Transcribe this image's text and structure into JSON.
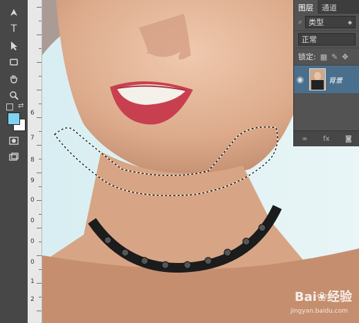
{
  "tools": {
    "pen": "pen-icon",
    "type": "T",
    "select": "arrow-icon",
    "shape": "rectangle-icon",
    "hand": "hand-icon",
    "zoom": "zoom-icon"
  },
  "colors": {
    "foreground": "#7fd3f0",
    "background": "#ffffff"
  },
  "ruler": {
    "labels": [
      "6",
      "7",
      "8",
      "9",
      "0",
      "0",
      "0",
      "0",
      "1",
      "2"
    ]
  },
  "layers_panel": {
    "tabs": [
      "图层",
      "通道"
    ],
    "filter_label": "类型",
    "blend_mode": "正常",
    "lock_label": "锁定:",
    "layer_name": "背景"
  },
  "watermark": {
    "brand_prefix": "Bai",
    "brand_suffix": "经验",
    "url": "jingyan.baidu.com"
  }
}
